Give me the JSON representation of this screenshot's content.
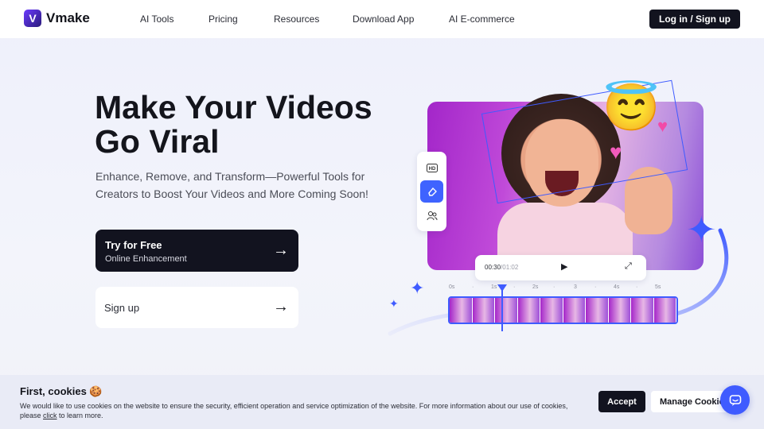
{
  "brand": {
    "name": "Vmake",
    "logo_letter": "V"
  },
  "nav": {
    "items": [
      {
        "label": "AI Tools"
      },
      {
        "label": "Pricing"
      },
      {
        "label": "Resources"
      },
      {
        "label": "Download App"
      },
      {
        "label": "AI E-commerce"
      }
    ],
    "login_label": "Log in / Sign up"
  },
  "hero": {
    "title": "Make Your Videos Go Viral",
    "subtitle": "Enhance, Remove, and Transform—Powerful Tools for Creators to Boost Your Videos and More Coming Soon!",
    "primary_cta": {
      "label": "Try for Free",
      "sublabel": "Online Enhancement",
      "icon": "arrow-right-icon"
    },
    "secondary_cta": {
      "label": "Sign up",
      "icon": "arrow-right-icon"
    }
  },
  "illustration": {
    "tools": [
      {
        "icon": "hd-icon",
        "label": "HD"
      },
      {
        "icon": "eraser-icon"
      },
      {
        "icon": "people-icon"
      }
    ],
    "player": {
      "current_time": "00:30",
      "total_time": "/01:02",
      "play_icon": "play-icon",
      "fullscreen_icon": "fullscreen-icon"
    },
    "ruler_ticks": [
      "0s",
      "·",
      "1s",
      "·",
      "2s",
      "·",
      "3",
      "·",
      "4s",
      "·",
      "5s"
    ],
    "frame_count": 10,
    "emoji": "😇"
  },
  "cookie_banner": {
    "title": "First, cookies 🍪",
    "text_before_link": "We would like to use cookies on the website to ensure the security, efficient operation and service optimization of the website. For more information about our use of cookies, please ",
    "link_text": "click",
    "text_after_link": " to learn more.",
    "accept_label": "Accept",
    "manage_label": "Manage Cookies"
  },
  "colors": {
    "accent": "#3f5bff",
    "dark": "#12131f",
    "video_purple": "#a326c9"
  }
}
